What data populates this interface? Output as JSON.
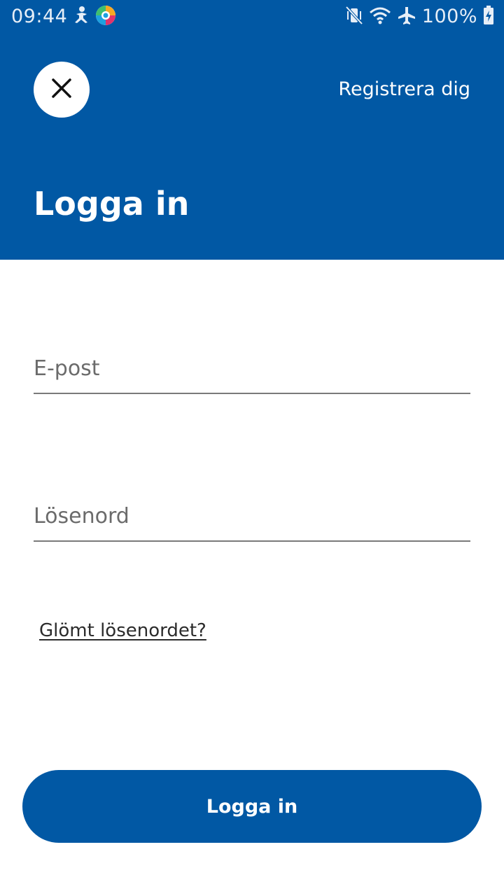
{
  "status_bar": {
    "time": "09:44",
    "battery_text": "100%",
    "left_icons": [
      "accessibility-icon",
      "browser-app-icon"
    ],
    "right_icons": [
      "vibrate-mute-icon",
      "wifi-icon",
      "airplane-mode-icon",
      "battery-charging-icon"
    ]
  },
  "header": {
    "close_icon": "close-icon",
    "register_label": "Registrera dig",
    "title": "Logga in",
    "background_color": "#0158a4"
  },
  "form": {
    "email_placeholder": "E-post",
    "email_value": "",
    "password_placeholder": "Lösenord",
    "password_value": "",
    "forgot_label": "Glömt lösenordet?",
    "submit_label": "Logga in"
  },
  "colors": {
    "brand": "#0158a4",
    "underline": "#7a7a7a",
    "placeholder": "#6b6b6b"
  }
}
